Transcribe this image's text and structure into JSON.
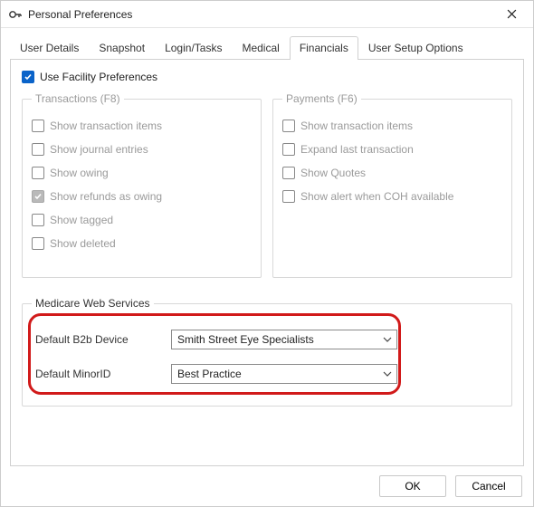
{
  "window": {
    "title": "Personal Preferences"
  },
  "tabs": [
    {
      "id": "user-details",
      "label": "User Details",
      "active": false
    },
    {
      "id": "snapshot",
      "label": "Snapshot",
      "active": false
    },
    {
      "id": "login-tasks",
      "label": "Login/Tasks",
      "active": false
    },
    {
      "id": "medical",
      "label": "Medical",
      "active": false
    },
    {
      "id": "financials",
      "label": "Financials",
      "active": true
    },
    {
      "id": "user-setup-options",
      "label": "User Setup Options",
      "active": false
    }
  ],
  "financials": {
    "use_facility_label": "Use Facility Preferences",
    "use_facility_checked": true,
    "transactions": {
      "legend": "Transactions (F8)",
      "items": [
        {
          "id": "show-transaction-items",
          "label": "Show transaction items",
          "checked": false
        },
        {
          "id": "show-journal-entries",
          "label": "Show journal entries",
          "checked": false
        },
        {
          "id": "show-owing",
          "label": "Show owing",
          "checked": false
        },
        {
          "id": "show-refunds-as-owing",
          "label": "Show refunds as owing",
          "checked": true
        },
        {
          "id": "show-tagged",
          "label": "Show tagged",
          "checked": false
        },
        {
          "id": "show-deleted",
          "label": "Show deleted",
          "checked": false
        }
      ]
    },
    "payments": {
      "legend": "Payments (F6)",
      "items": [
        {
          "id": "p-show-transaction-items",
          "label": "Show transaction items",
          "checked": false
        },
        {
          "id": "expand-last-transaction",
          "label": "Expand last transaction",
          "checked": false
        },
        {
          "id": "show-quotes",
          "label": "Show Quotes",
          "checked": false
        },
        {
          "id": "show-alert-coh",
          "label": "Show alert when COH available",
          "checked": false
        }
      ]
    },
    "mws": {
      "legend": "Medicare Web Services",
      "b2b_label": "Default B2b Device",
      "b2b_value": "Smith Street Eye Specialists",
      "minor_label": "Default MinorID",
      "minor_value": "Best Practice"
    }
  },
  "buttons": {
    "ok": "OK",
    "cancel": "Cancel"
  }
}
